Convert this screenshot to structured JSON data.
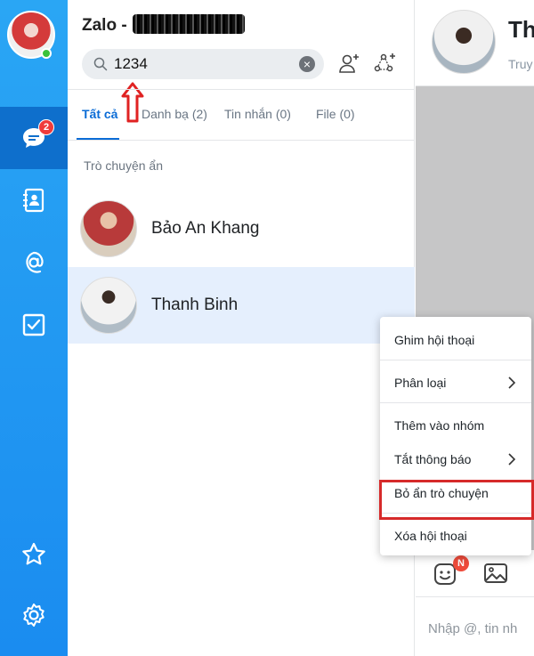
{
  "app": {
    "title": "Zalo -"
  },
  "search": {
    "value": "1234",
    "placeholder": ""
  },
  "tabs": [
    {
      "label": "Tất cả"
    },
    {
      "label": "Danh bạ (2)"
    },
    {
      "label": "Tin nhắn (0)"
    },
    {
      "label": "File (0)"
    }
  ],
  "section": {
    "title": "Trò chuyện ẩn"
  },
  "conversations": [
    {
      "name": "Bảo An Khang"
    },
    {
      "name": "Thanh Binh"
    }
  ],
  "rail": {
    "messages_badge": "2"
  },
  "chat": {
    "name_partial": "Th",
    "subtitle_partial": "Truy",
    "composer_placeholder": "Nhập @, tin nh",
    "sticker_badge": "N"
  },
  "context_menu": {
    "items": [
      {
        "label": "Ghim hội thoại"
      },
      {
        "label": "Phân loại"
      },
      {
        "label": "Thêm vào nhóm"
      },
      {
        "label": "Tắt thông báo"
      },
      {
        "label": "Bỏ ẩn trò chuyện"
      },
      {
        "label": "Xóa hội thoại"
      }
    ]
  },
  "colors": {
    "accent": "#0b6cd6",
    "rail": "#1a8cf0",
    "highlight": "#d62a2a"
  }
}
